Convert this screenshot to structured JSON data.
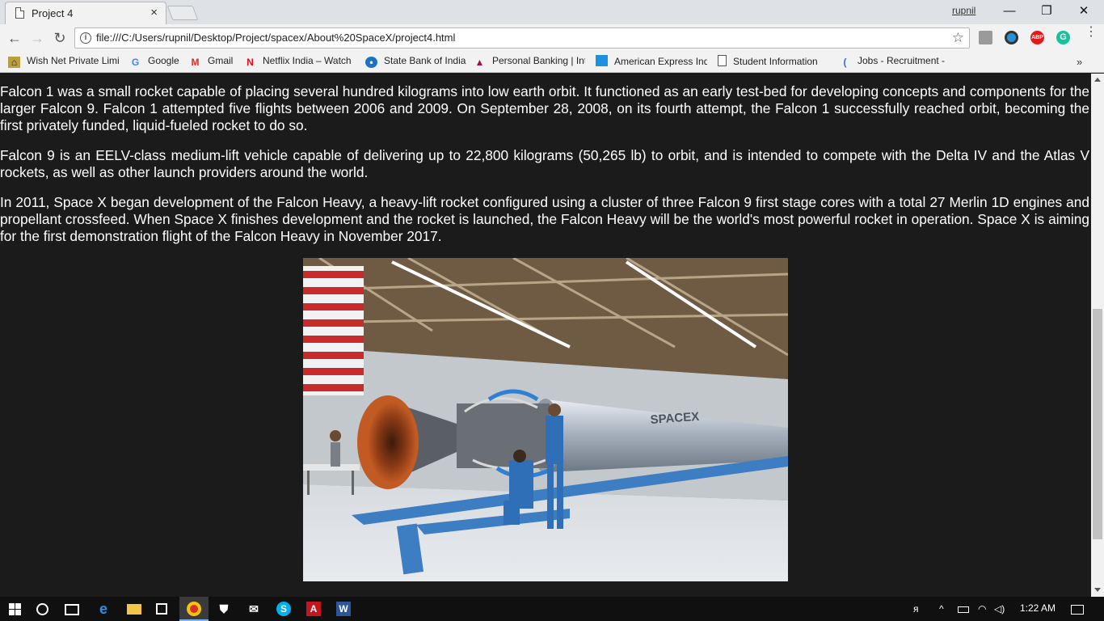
{
  "tab": {
    "title": "Project 4",
    "close": "×"
  },
  "window": {
    "profile": "rupnil",
    "minimize": "—",
    "maximize": "❐",
    "close": "✕"
  },
  "nav": {
    "back": "←",
    "forward": "→",
    "reload": "↻"
  },
  "omnibox": {
    "url": "file:///C:/Users/rupnil/Desktop/Project/spacex/About%20SpaceX/project4.html",
    "info": "i",
    "star": "☆"
  },
  "extensions": {
    "abp": "ABP",
    "grammarly": "G",
    "menu": "⋮"
  },
  "bookmarks": [
    {
      "label": "Wish Net Private Limi",
      "icon": "wishnet-icon"
    },
    {
      "label": "Google",
      "icon": "google-icon"
    },
    {
      "label": "Gmail",
      "icon": "gmail-icon"
    },
    {
      "label": "Netflix India – Watch",
      "icon": "netflix-icon"
    },
    {
      "label": "State Bank of India",
      "icon": "sbi-icon"
    },
    {
      "label": "Personal Banking | Int",
      "icon": "axis-icon"
    },
    {
      "label": "American Express Ind",
      "icon": "amex-icon"
    },
    {
      "label": "Student Information",
      "icon": "page-icon"
    },
    {
      "label": "Jobs - Recruitment -",
      "icon": "jobs-icon"
    }
  ],
  "bookmarks_more": "»",
  "content": {
    "paragraphs": [
      "Falcon 1 was a small rocket capable of placing several hundred kilograms into low earth orbit. It functioned as an early test-bed for developing concepts and components for the larger Falcon 9. Falcon 1 attempted five flights between 2006 and 2009. On September 28, 2008, on its fourth attempt, the Falcon 1 successfully reached orbit, becoming the first privately funded, liquid-fueled rocket to do so.",
      "Falcon 9 is an EELV-class medium-lift vehicle capable of delivering up to 22,800 kilograms (50,265 lb) to orbit, and is intended to compete with the Delta IV and the Atlas V rockets, as well as other launch providers around the world.",
      "In 2011, Space X began development of the Falcon Heavy, a heavy-lift rocket configured using a cluster of three Falcon 9 first stage cores with a total 27 Merlin 1D engines and propellant crossfeed. When Space X finishes development and the rocket is launched, the Falcon Heavy will be the world's most powerful rocket in operation. Space X is aiming for the first demonstration flight of the Falcon Heavy in November 2017."
    ],
    "image_label": "SPACEX"
  },
  "taskbar": {
    "time": "1:22 AM"
  },
  "colors": {
    "page_bg": "#1b1b1b",
    "text": "#ffffff",
    "taskbar": "#101010"
  }
}
